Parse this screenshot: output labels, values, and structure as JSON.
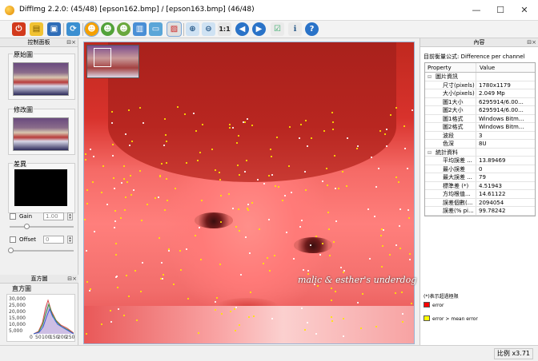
{
  "window": {
    "title": "DiffImg 2.2.0:  (45/48) [epson162.bmp] / [epson163.bmp] (46/48)",
    "minimize": "—",
    "maximize": "☐",
    "close": "✕"
  },
  "toolbar": {
    "icons": [
      "power-icon",
      "open-folder-icon",
      "save-icon",
      "refresh-icon",
      "emoji-green-icon",
      "emoji-yellow-icon",
      "emoji-blue-icon",
      "split-view-icon",
      "monitor-icon",
      "mask-icon",
      "zoom-in-icon",
      "zoom-out-icon",
      "zoom-1to1-icon",
      "previous-icon",
      "next-icon",
      "checklist-icon",
      "info-icon",
      "help-icon"
    ]
  },
  "left_panel": {
    "title": "控制面板",
    "original_label": "原始圖",
    "modified_label": "修改圖",
    "diff_label": "差異",
    "gain_label": "Gain",
    "gain_value": "1.00",
    "offset_label": "Offset",
    "offset_value": "0",
    "histogram_title": "直方圖",
    "histogram_y_ticks": [
      "30,000",
      "25,000",
      "20,000",
      "15,000",
      "10,000",
      "5,000"
    ],
    "histogram_x_ticks": [
      "0",
      "50",
      "100",
      "150",
      "200",
      "250"
    ]
  },
  "right_panel": {
    "title": "內容",
    "formula": "目前衡量公式: Difference per channel",
    "columns": [
      "Property",
      "Value"
    ],
    "groups": [
      {
        "name": "圖片資訊",
        "rows": [
          {
            "k": "尺寸(pixels)",
            "v": "1780x1179"
          },
          {
            "k": "大小(pixels)",
            "v": "2.049 Mp"
          },
          {
            "k": "圖1大小",
            "v": "6295914/6.00..."
          },
          {
            "k": "圖2大小",
            "v": "6295914/6.00..."
          },
          {
            "k": "圖1格式",
            "v": "Windows Bitm..."
          },
          {
            "k": "圖2格式",
            "v": "Windows Bitm..."
          },
          {
            "k": "波段",
            "v": "3"
          },
          {
            "k": "色深",
            "v": "8U"
          }
        ]
      },
      {
        "name": "統計資料",
        "rows": [
          {
            "k": "平均誤差 ...",
            "v": "13.89469"
          },
          {
            "k": "最小誤差",
            "v": "0"
          },
          {
            "k": "最大誤差 ...",
            "v": "79"
          },
          {
            "k": "標準差 (*)",
            "v": "4.51943"
          },
          {
            "k": "方均根值...",
            "v": "14.61122"
          },
          {
            "k": "誤差個數(...",
            "v": "2094054"
          },
          {
            "k": "誤差(% pi...",
            "v": "99.78242"
          }
        ]
      }
    ],
    "note": "(*)表示超過極限",
    "legend": [
      {
        "label": "error",
        "color": "#ff0000"
      },
      {
        "label": "error > mean error",
        "color": "#ffff00"
      }
    ]
  },
  "main_view": {
    "watermark": "malic & esther's underdog"
  },
  "status": {
    "zoom": "比例 x3.71"
  },
  "colors": {
    "accent": "#4a78b8",
    "error": "#ff0000",
    "warn": "#ffff00"
  }
}
